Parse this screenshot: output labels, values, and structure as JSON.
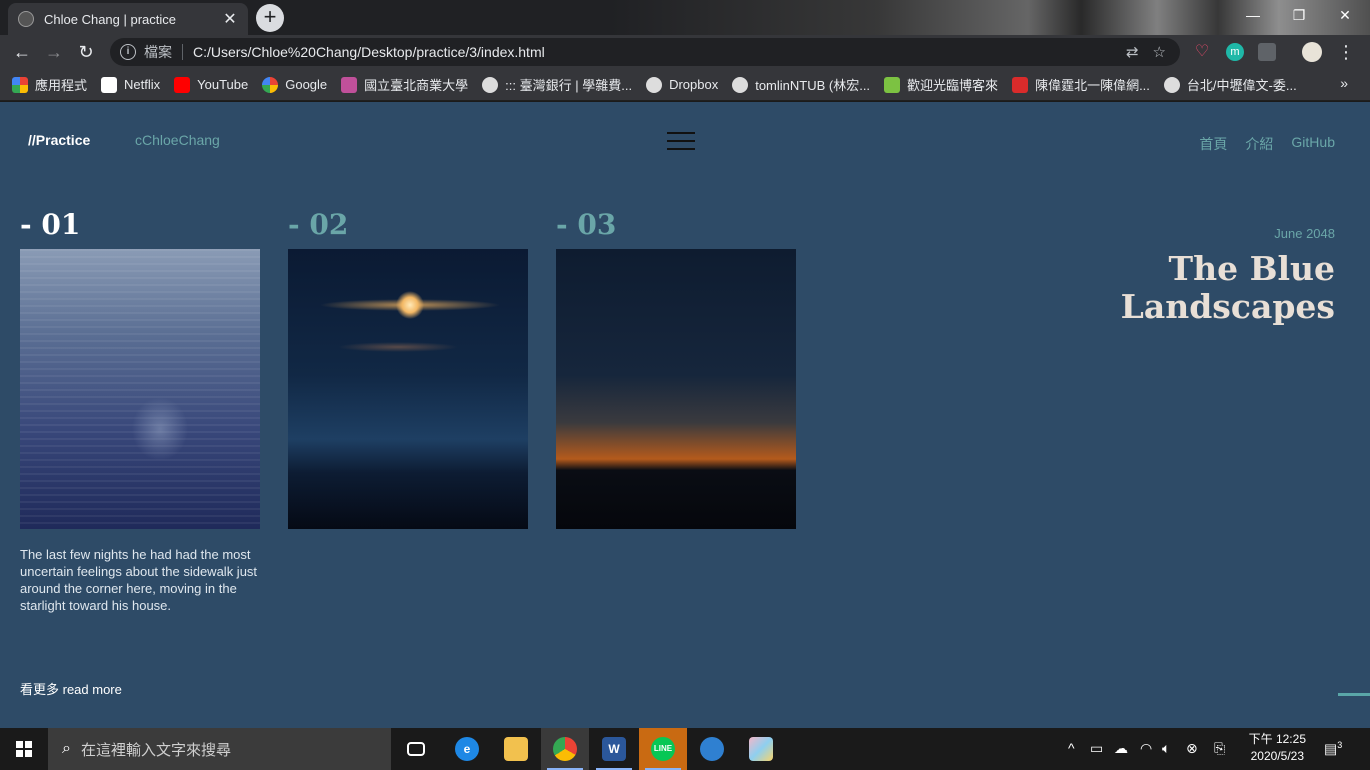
{
  "browser": {
    "tab_title": "Chloe Chang | practice",
    "tab_close": "✕",
    "new_tab": "+",
    "window_minimize": "—",
    "window_restore": "❐",
    "window_close": "✕",
    "back": "←",
    "forward": "→",
    "reload": "↻",
    "security_label": "檔案",
    "url": "C:/Users/Chloe%20Chang/Desktop/practice/3/index.html",
    "translate_icon": "⇄",
    "star_icon": "☆",
    "menu_icon": "⋮",
    "bookmarks": [
      {
        "label": "應用程式",
        "color": "#e94235"
      },
      {
        "label": "Netflix",
        "color": "#ffffff"
      },
      {
        "label": "YouTube",
        "color": "#ff0000"
      },
      {
        "label": "Google",
        "color": "#4285f4"
      },
      {
        "label": "國立臺北商業大學",
        "color": "#c0509a"
      },
      {
        "label": "::: 臺灣銀行 | 學雜費...",
        "color": "#dddddd"
      },
      {
        "label": "Dropbox",
        "color": "#dddddd"
      },
      {
        "label": "tomlinNTUB (林宏...",
        "color": "#dddddd"
      },
      {
        "label": "歡迎光臨博客來",
        "color": "#7cc242"
      },
      {
        "label": "陳偉霆北一陳偉網...",
        "color": "#d92b2b"
      },
      {
        "label": "台北/中壢偉文-委...",
        "color": "#dddddd"
      }
    ],
    "bookmarks_more": "»"
  },
  "site": {
    "brand": "//Practice",
    "handle": "cChloeChang",
    "nav": [
      "首頁",
      "介紹",
      "GitHub"
    ],
    "cards": [
      {
        "number": "- 01",
        "color": "#ffffff"
      },
      {
        "number": "- 02",
        "color": "#6aa6a8"
      },
      {
        "number": "- 03",
        "color": "#6aa6a8"
      }
    ],
    "lede": "The last few nights he had had the most uncertain feelings about the sidewalk just around the corner here, moving in the starlight toward his house.",
    "read_more": "看更多 read more",
    "date": "June 2048",
    "headline": "The Blue Landscapes"
  },
  "taskbar": {
    "search_placeholder": "在這裡輸入文字來搜尋",
    "time": "下午 12:25",
    "date": "2020/5/23",
    "notifications": "3"
  }
}
